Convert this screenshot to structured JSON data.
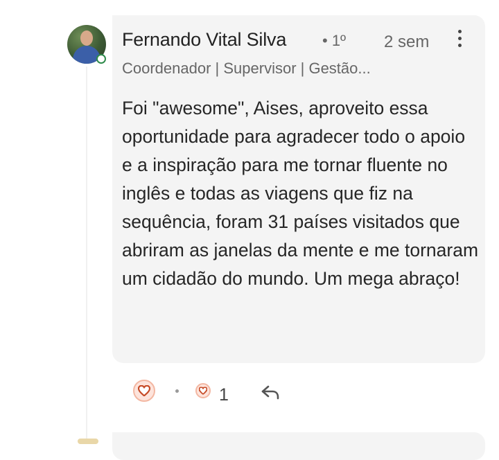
{
  "comment": {
    "author": {
      "name": "Fernando Vital Silva",
      "connection_degree": "• 1º",
      "headline": "Coordenador | Supervisor | Gestão...",
      "avatar_icon": "profile-photo",
      "online": true
    },
    "timestamp": "2 sem",
    "text": "Foi \"awesome\", Aises, aproveito essa oportunidade para agradecer todo o apoio e a inspiração para me tornar fluente no inglês e todas as viagens que fiz na sequência, foram 31 países visitados que abriram as janelas da mente e me tornaram um cidadão do mundo. Um mega abraço!"
  },
  "actions": {
    "react_icon": "heart-icon",
    "reaction_icon": "heart-icon",
    "reaction_count": "1",
    "reply_icon": "reply-arrow-icon",
    "more_icon": "more-vertical-icon"
  },
  "colors": {
    "bubble": "#f4f4f4",
    "heart_stroke": "#c64a26",
    "heart_fill": "#fde4dc",
    "online": "#2e8a4a"
  }
}
